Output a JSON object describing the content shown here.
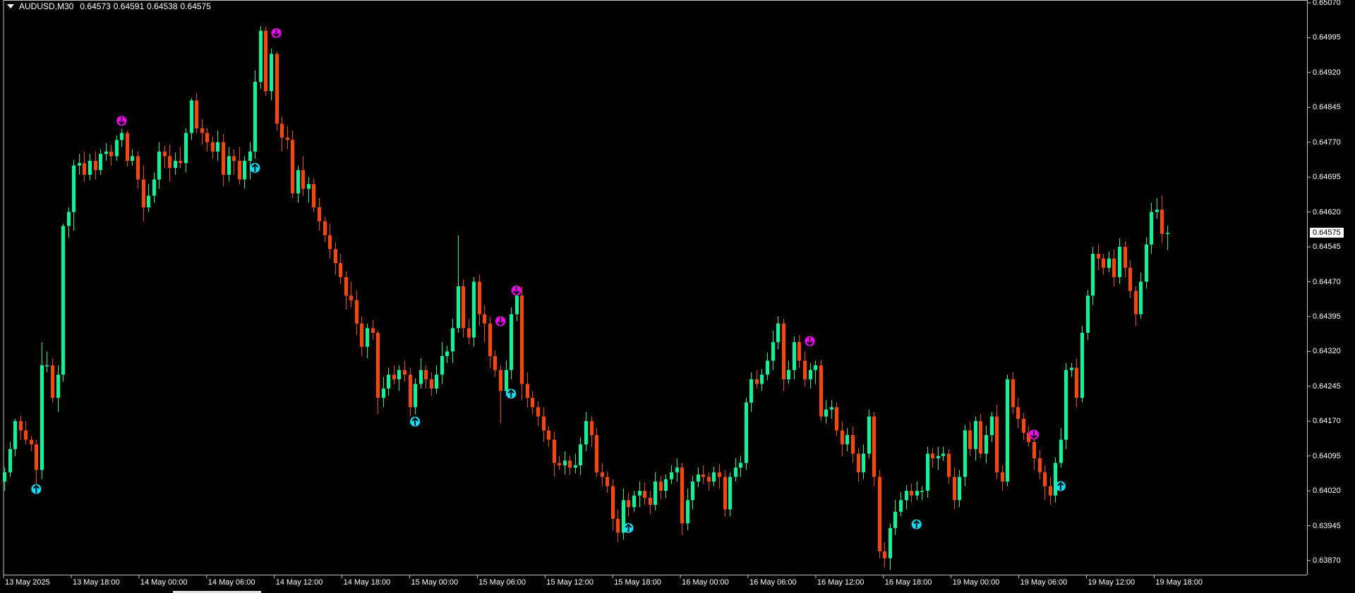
{
  "header": {
    "symbol": "AUDUSD,M30",
    "open": "0.64573",
    "high": "0.64591",
    "low": "0.64538",
    "close": "0.64575"
  },
  "colors": {
    "bull": "#00FA9A",
    "bear": "#FF4500",
    "sell_signal": "#FF00FF",
    "buy_signal": "#00E5FF",
    "background": "#000000",
    "frame": "#C0C0C0"
  },
  "price_axis": {
    "labels": [
      "0.65070",
      "0.64995",
      "0.64920",
      "0.64845",
      "0.64770",
      "0.64695",
      "0.64620",
      "0.64545",
      "0.64470",
      "0.64395",
      "0.64320",
      "0.64245",
      "0.64170",
      "0.64095",
      "0.64020",
      "0.63945",
      "0.63870"
    ],
    "current": "0.64575"
  },
  "time_axis": {
    "labels": [
      "13 May 2025",
      "13 May 18:00",
      "14 May 00:00",
      "14 May 06:00",
      "14 May 12:00",
      "14 May 18:00",
      "15 May 00:00",
      "15 May 06:00",
      "15 May 12:00",
      "15 May 18:00",
      "16 May 00:00",
      "16 May 06:00",
      "16 May 12:00",
      "16 May 18:00",
      "19 May 00:00",
      "19 May 06:00",
      "19 May 12:00",
      "19 May 18:00"
    ]
  },
  "chart_data": {
    "type": "candlestick",
    "title": "AUDUSD,M30",
    "ylim": [
      0.6387,
      0.6507
    ],
    "first_open": 0.6404,
    "point": 1e-05,
    "close": [
      0.6406,
      0.6411,
      0.6417,
      0.6415,
      0.6413,
      0.6412,
      0.64065,
      0.6429,
      0.6429,
      0.6422,
      0.6427,
      0.6459,
      0.6462,
      0.6472,
      0.64725,
      0.647,
      0.6473,
      0.6471,
      0.64745,
      0.6475,
      0.6474,
      0.64775,
      0.6479,
      0.6473,
      0.6474,
      0.6469,
      0.6463,
      0.64655,
      0.6469,
      0.6475,
      0.6474,
      0.64715,
      0.6473,
      0.64725,
      0.6479,
      0.6486,
      0.648,
      0.6479,
      0.6477,
      0.6475,
      0.6477,
      0.647,
      0.6474,
      0.6473,
      0.6469,
      0.6473,
      0.6475,
      0.649,
      0.6501,
      0.6488,
      0.6496,
      0.6481,
      0.6478,
      0.64775,
      0.6466,
      0.6471,
      0.6467,
      0.6468,
      0.6463,
      0.646,
      0.6457,
      0.6454,
      0.6451,
      0.6448,
      0.6444,
      0.6443,
      0.6438,
      0.6433,
      0.6437,
      0.6436,
      0.6422,
      0.6424,
      0.6427,
      0.6426,
      0.6428,
      0.6427,
      0.642,
      0.6425,
      0.6428,
      0.6426,
      0.6424,
      0.6427,
      0.6431,
      0.6432,
      0.6437,
      0.6446,
      0.6437,
      0.6435,
      0.6447,
      0.644,
      0.6438,
      0.6431,
      0.6428,
      0.64235,
      0.6428,
      0.644,
      0.6444,
      0.6425,
      0.6422,
      0.642,
      0.6418,
      0.6415,
      0.6413,
      0.6408,
      0.64075,
      0.64085,
      0.6407,
      0.64075,
      0.6412,
      0.6417,
      0.6414,
      0.6406,
      0.6405,
      0.6403,
      0.6396,
      0.6393,
      0.64,
      0.63985,
      0.6401,
      0.6402,
      0.64005,
      0.6399,
      0.6404,
      0.6402,
      0.64045,
      0.6406,
      0.6407,
      0.6395,
      0.64,
      0.6404,
      0.64055,
      0.6405,
      0.6404,
      0.6406,
      0.6405,
      0.6398,
      0.6405,
      0.6407,
      0.6408,
      0.6421,
      0.6426,
      0.6425,
      0.6427,
      0.643,
      0.6434,
      0.6438,
      0.6426,
      0.6428,
      0.6434,
      0.643,
      0.6426,
      0.6428,
      0.6429,
      0.6418,
      0.64195,
      0.642,
      0.6415,
      0.6412,
      0.6414,
      0.641,
      0.6406,
      0.641,
      0.6418,
      0.6405,
      0.6389,
      0.63875,
      0.6394,
      0.63975,
      0.64,
      0.6402,
      0.6401,
      0.6402,
      0.6402,
      0.641,
      0.6409,
      0.64095,
      0.641,
      0.6405,
      0.64,
      0.6405,
      0.6415,
      0.6411,
      0.6417,
      0.641,
      0.6414,
      0.6418,
      0.6406,
      0.6404,
      0.6426,
      0.642,
      0.64175,
      0.64145,
      0.64125,
      0.6409,
      0.6406,
      0.6403,
      0.6401,
      0.6408,
      0.6413,
      0.6428,
      0.64285,
      0.6422,
      0.6436,
      0.6444,
      0.6453,
      0.6452,
      0.645,
      0.6452,
      0.6448,
      0.64545,
      0.645,
      0.6445,
      0.644,
      0.6447,
      0.6455,
      0.6462,
      0.64625,
      0.64573,
      0.64575
    ],
    "upper_wick_points": [
      10,
      15,
      5,
      12,
      20,
      8,
      10,
      50,
      30,
      15,
      20,
      5,
      10,
      12,
      20,
      25,
      15,
      20,
      10,
      18,
      15,
      10,
      8,
      5,
      15,
      10,
      30,
      25,
      15,
      20,
      12,
      25,
      18,
      30,
      10,
      5,
      15,
      20,
      10,
      12,
      25,
      18,
      20,
      15,
      30,
      10,
      20,
      25,
      10,
      8,
      12,
      5,
      15,
      25,
      20,
      10,
      30,
      15,
      12,
      20,
      10,
      25,
      15,
      20,
      12,
      30,
      20,
      15,
      10,
      18,
      5,
      25,
      15,
      20,
      10,
      20,
      15,
      12,
      25,
      10,
      15,
      20,
      30,
      12,
      20,
      110,
      15,
      20,
      10,
      15,
      20,
      15,
      12,
      10,
      20,
      15,
      10,
      20,
      25,
      15,
      12,
      20,
      10,
      18,
      15,
      20,
      10,
      25,
      15,
      20,
      10,
      15,
      20,
      12,
      15,
      20,
      25,
      15,
      10,
      20,
      18,
      15,
      20,
      12,
      10,
      15,
      20,
      10,
      25,
      12,
      15,
      20,
      10,
      12,
      18,
      15,
      10,
      20,
      15,
      10,
      15,
      20,
      12,
      18,
      25,
      15,
      10,
      20,
      12,
      15,
      20,
      15,
      10,
      12,
      20,
      15,
      10,
      20,
      15,
      18,
      12,
      20,
      15,
      10,
      15,
      20,
      10,
      25,
      18,
      12,
      15,
      20,
      10,
      15,
      12,
      20,
      15,
      10,
      20,
      15,
      12,
      18,
      10,
      15,
      20,
      10,
      25,
      15,
      10,
      15,
      20,
      12,
      15,
      10,
      18,
      15,
      20,
      12,
      25,
      15,
      10,
      20,
      15,
      12,
      15,
      20,
      10,
      15,
      20,
      18,
      12,
      15,
      10,
      20,
      15,
      20,
      25,
      30,
      16
    ],
    "lower_wick_points": [
      20,
      10,
      15,
      20,
      10,
      15,
      30,
      20,
      15,
      10,
      30,
      15,
      25,
      40,
      20,
      15,
      12,
      20,
      10,
      15,
      20,
      10,
      15,
      12,
      10,
      20,
      30,
      10,
      15,
      20,
      25,
      30,
      15,
      10,
      20,
      15,
      10,
      25,
      20,
      15,
      20,
      25,
      15,
      30,
      10,
      20,
      40,
      15,
      15,
      10,
      20,
      15,
      30,
      20,
      10,
      20,
      15,
      30,
      10,
      20,
      15,
      20,
      25,
      15,
      30,
      15,
      25,
      20,
      25,
      15,
      35,
      20,
      15,
      10,
      25,
      15,
      20,
      15,
      10,
      20,
      15,
      10,
      20,
      15,
      25,
      10,
      20,
      15,
      20,
      25,
      40,
      25,
      15,
      70,
      10,
      20,
      15,
      35,
      20,
      15,
      20,
      25,
      15,
      30,
      10,
      20,
      15,
      12,
      20,
      15,
      25,
      10,
      20,
      15,
      25,
      20,
      15,
      20,
      10,
      25,
      15,
      20,
      12,
      18,
      15,
      10,
      20,
      25,
      15,
      20,
      12,
      15,
      20,
      10,
      25,
      15,
      15,
      10,
      20,
      15,
      20,
      10,
      15,
      12,
      20,
      15,
      25,
      10,
      20,
      15,
      15,
      20,
      30,
      10,
      15,
      20,
      12,
      25,
      15,
      20,
      20,
      15,
      10,
      20,
      15,
      20,
      25,
      15,
      10,
      20,
      15,
      10,
      20,
      15,
      20,
      25,
      10,
      15,
      20,
      15,
      20,
      15,
      25,
      10,
      20,
      15,
      15,
      20,
      10,
      15,
      20,
      15,
      10,
      25,
      15,
      30,
      20,
      15,
      10,
      20,
      15,
      20,
      10,
      15,
      20,
      25,
      15,
      10,
      20,
      15,
      20,
      15,
      25,
      10,
      15,
      20,
      15,
      20,
      35
    ],
    "signals": [
      {
        "type": "sell",
        "bar": 22,
        "price": 0.64816
      },
      {
        "type": "sell",
        "bar": 51,
        "price": 0.65005
      },
      {
        "type": "sell",
        "bar": 93,
        "price": 0.64385
      },
      {
        "type": "sell",
        "bar": 96,
        "price": 0.64451
      },
      {
        "type": "sell",
        "bar": 151,
        "price": 0.64342
      },
      {
        "type": "sell",
        "bar": 193,
        "price": 0.64141
      },
      {
        "type": "buy",
        "bar": 6,
        "price": 0.64024
      },
      {
        "type": "buy",
        "bar": 47,
        "price": 0.64715
      },
      {
        "type": "buy",
        "bar": 77,
        "price": 0.64169
      },
      {
        "type": "buy",
        "bar": 95,
        "price": 0.64229
      },
      {
        "type": "buy",
        "bar": 117,
        "price": 0.6394
      },
      {
        "type": "buy",
        "bar": 171,
        "price": 0.63948
      },
      {
        "type": "buy",
        "bar": 198,
        "price": 0.6403
      }
    ]
  }
}
